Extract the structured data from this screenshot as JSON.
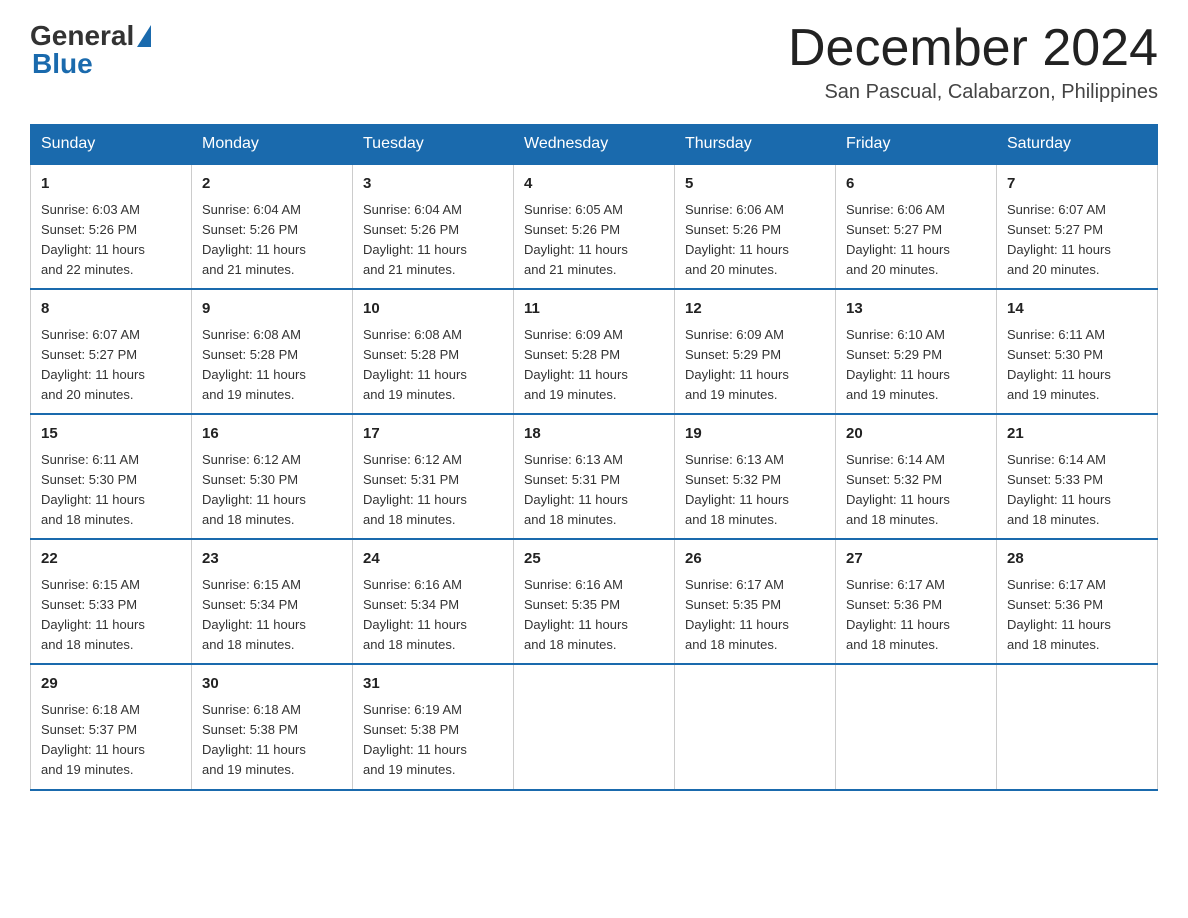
{
  "header": {
    "logo_general": "General",
    "logo_blue": "Blue",
    "month_title": "December 2024",
    "location": "San Pascual, Calabarzon, Philippines"
  },
  "days_of_week": [
    "Sunday",
    "Monday",
    "Tuesday",
    "Wednesday",
    "Thursday",
    "Friday",
    "Saturday"
  ],
  "weeks": [
    [
      {
        "day": "1",
        "sunrise": "6:03 AM",
        "sunset": "5:26 PM",
        "daylight": "11 hours and 22 minutes."
      },
      {
        "day": "2",
        "sunrise": "6:04 AM",
        "sunset": "5:26 PM",
        "daylight": "11 hours and 21 minutes."
      },
      {
        "day": "3",
        "sunrise": "6:04 AM",
        "sunset": "5:26 PM",
        "daylight": "11 hours and 21 minutes."
      },
      {
        "day": "4",
        "sunrise": "6:05 AM",
        "sunset": "5:26 PM",
        "daylight": "11 hours and 21 minutes."
      },
      {
        "day": "5",
        "sunrise": "6:06 AM",
        "sunset": "5:26 PM",
        "daylight": "11 hours and 20 minutes."
      },
      {
        "day": "6",
        "sunrise": "6:06 AM",
        "sunset": "5:27 PM",
        "daylight": "11 hours and 20 minutes."
      },
      {
        "day": "7",
        "sunrise": "6:07 AM",
        "sunset": "5:27 PM",
        "daylight": "11 hours and 20 minutes."
      }
    ],
    [
      {
        "day": "8",
        "sunrise": "6:07 AM",
        "sunset": "5:27 PM",
        "daylight": "11 hours and 20 minutes."
      },
      {
        "day": "9",
        "sunrise": "6:08 AM",
        "sunset": "5:28 PM",
        "daylight": "11 hours and 19 minutes."
      },
      {
        "day": "10",
        "sunrise": "6:08 AM",
        "sunset": "5:28 PM",
        "daylight": "11 hours and 19 minutes."
      },
      {
        "day": "11",
        "sunrise": "6:09 AM",
        "sunset": "5:28 PM",
        "daylight": "11 hours and 19 minutes."
      },
      {
        "day": "12",
        "sunrise": "6:09 AM",
        "sunset": "5:29 PM",
        "daylight": "11 hours and 19 minutes."
      },
      {
        "day": "13",
        "sunrise": "6:10 AM",
        "sunset": "5:29 PM",
        "daylight": "11 hours and 19 minutes."
      },
      {
        "day": "14",
        "sunrise": "6:11 AM",
        "sunset": "5:30 PM",
        "daylight": "11 hours and 19 minutes."
      }
    ],
    [
      {
        "day": "15",
        "sunrise": "6:11 AM",
        "sunset": "5:30 PM",
        "daylight": "11 hours and 18 minutes."
      },
      {
        "day": "16",
        "sunrise": "6:12 AM",
        "sunset": "5:30 PM",
        "daylight": "11 hours and 18 minutes."
      },
      {
        "day": "17",
        "sunrise": "6:12 AM",
        "sunset": "5:31 PM",
        "daylight": "11 hours and 18 minutes."
      },
      {
        "day": "18",
        "sunrise": "6:13 AM",
        "sunset": "5:31 PM",
        "daylight": "11 hours and 18 minutes."
      },
      {
        "day": "19",
        "sunrise": "6:13 AM",
        "sunset": "5:32 PM",
        "daylight": "11 hours and 18 minutes."
      },
      {
        "day": "20",
        "sunrise": "6:14 AM",
        "sunset": "5:32 PM",
        "daylight": "11 hours and 18 minutes."
      },
      {
        "day": "21",
        "sunrise": "6:14 AM",
        "sunset": "5:33 PM",
        "daylight": "11 hours and 18 minutes."
      }
    ],
    [
      {
        "day": "22",
        "sunrise": "6:15 AM",
        "sunset": "5:33 PM",
        "daylight": "11 hours and 18 minutes."
      },
      {
        "day": "23",
        "sunrise": "6:15 AM",
        "sunset": "5:34 PM",
        "daylight": "11 hours and 18 minutes."
      },
      {
        "day": "24",
        "sunrise": "6:16 AM",
        "sunset": "5:34 PM",
        "daylight": "11 hours and 18 minutes."
      },
      {
        "day": "25",
        "sunrise": "6:16 AM",
        "sunset": "5:35 PM",
        "daylight": "11 hours and 18 minutes."
      },
      {
        "day": "26",
        "sunrise": "6:17 AM",
        "sunset": "5:35 PM",
        "daylight": "11 hours and 18 minutes."
      },
      {
        "day": "27",
        "sunrise": "6:17 AM",
        "sunset": "5:36 PM",
        "daylight": "11 hours and 18 minutes."
      },
      {
        "day": "28",
        "sunrise": "6:17 AM",
        "sunset": "5:36 PM",
        "daylight": "11 hours and 18 minutes."
      }
    ],
    [
      {
        "day": "29",
        "sunrise": "6:18 AM",
        "sunset": "5:37 PM",
        "daylight": "11 hours and 19 minutes."
      },
      {
        "day": "30",
        "sunrise": "6:18 AM",
        "sunset": "5:38 PM",
        "daylight": "11 hours and 19 minutes."
      },
      {
        "day": "31",
        "sunrise": "6:19 AM",
        "sunset": "5:38 PM",
        "daylight": "11 hours and 19 minutes."
      },
      null,
      null,
      null,
      null
    ]
  ],
  "labels": {
    "sunrise": "Sunrise:",
    "sunset": "Sunset:",
    "daylight": "Daylight:"
  }
}
